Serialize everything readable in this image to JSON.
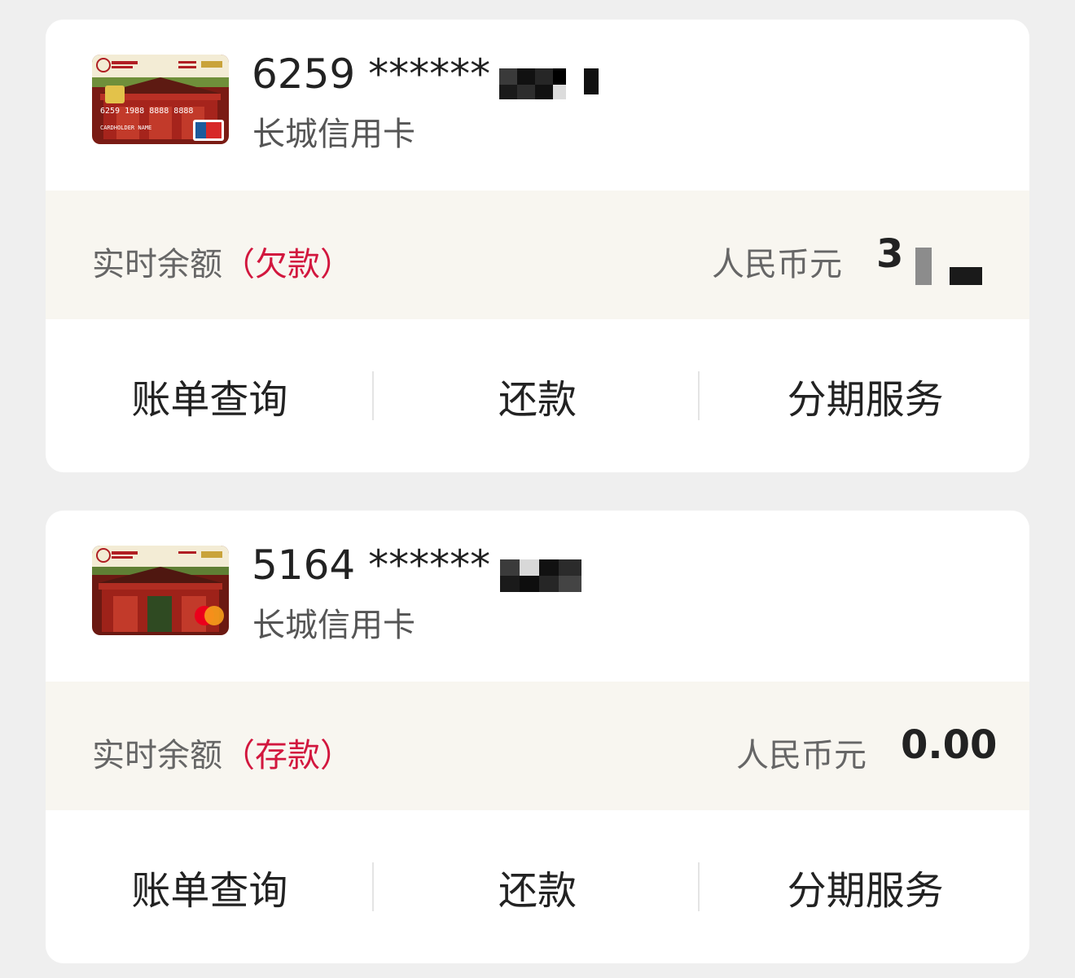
{
  "cards": [
    {
      "number": "6259 ******",
      "name": "长城信用卡",
      "balance_label": "实时余额",
      "balance_type": "（欠款）",
      "currency": "人民币元",
      "amount": "3",
      "actions": [
        "账单查询",
        "还款",
        "分期服务"
      ]
    },
    {
      "number": "5164 ******",
      "name": "长城信用卡",
      "balance_label": "实时余额",
      "balance_type": "（存款）",
      "currency": "人民币元",
      "amount": "0.00",
      "actions": [
        "账单查询",
        "还款",
        "分期服务"
      ]
    }
  ],
  "colors": {
    "accent_red": "#d2173e",
    "balance_bg": "#f8f6f0",
    "page_bg": "#efefef"
  }
}
